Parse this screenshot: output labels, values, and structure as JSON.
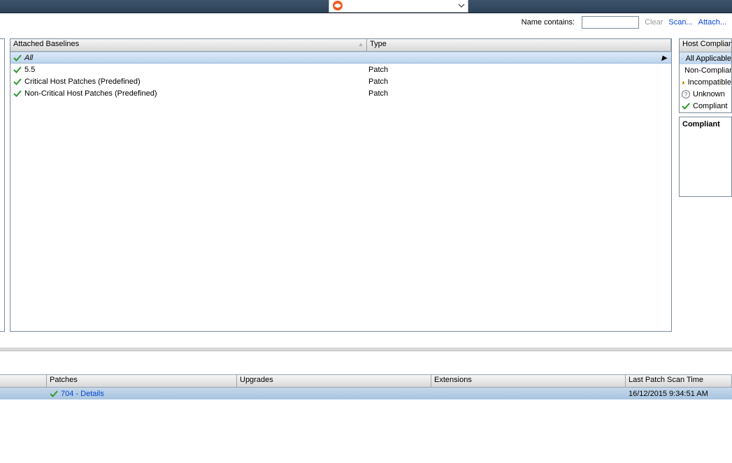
{
  "toolbar": {
    "nameContainsLabel": "Name contains:",
    "nameContainsValue": "",
    "clear": "Clear",
    "scan": "Scan...",
    "attach": "Attach..."
  },
  "baselines": {
    "headers": {
      "name": "Attached Baselines",
      "type": "Type"
    },
    "allLabel": "All",
    "rows": [
      {
        "name": "5.5",
        "type": "Patch"
      },
      {
        "name": "Critical Host Patches (Predefined)",
        "type": "Patch"
      },
      {
        "name": "Non-Critical Host Patches (Predefined)",
        "type": "Patch"
      }
    ]
  },
  "compliance": {
    "header": "Host Compliance",
    "items": [
      {
        "label": "All Applicable",
        "icon": "stack"
      },
      {
        "label": "Non-Compliant",
        "icon": "error"
      },
      {
        "label": "Incompatible",
        "icon": "warn"
      },
      {
        "label": "Unknown",
        "icon": "question"
      },
      {
        "label": "Compliant",
        "icon": "check"
      }
    ],
    "statusSummary": "Compliant"
  },
  "bottom": {
    "headers": {
      "patches": "Patches",
      "upgrades": "Upgrades",
      "extensions": "Extensions",
      "lastScan": "Last Patch Scan Time"
    },
    "row": {
      "patchesLink": "704 - Details",
      "lastScan": "16/12/2015 9:34:51 AM"
    }
  }
}
